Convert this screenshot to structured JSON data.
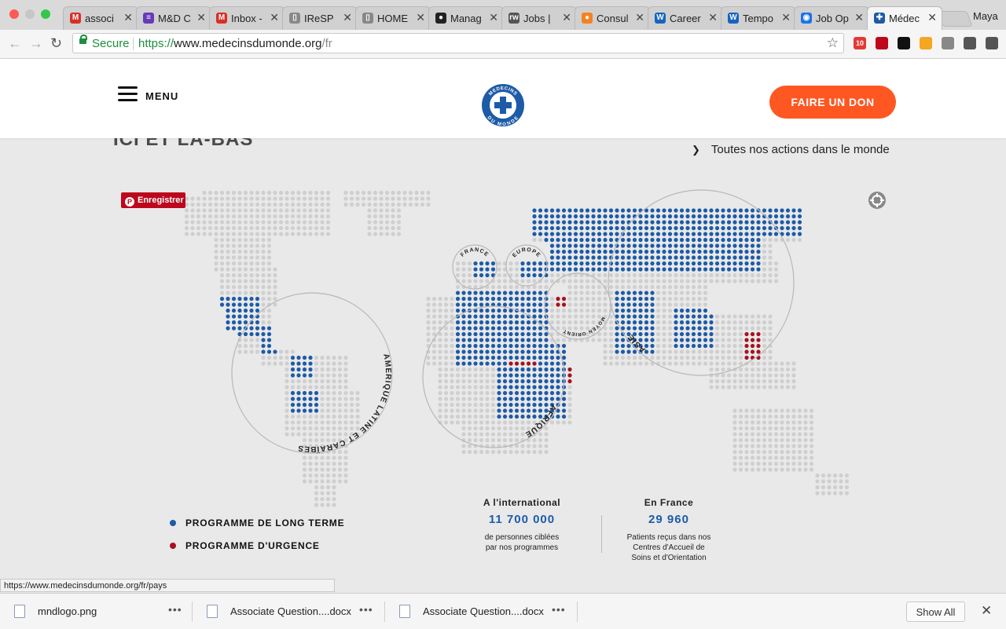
{
  "browser": {
    "tabs": [
      {
        "title": "associ",
        "icon": "gmail-icon",
        "color": "#d93025",
        "glyph": "M"
      },
      {
        "title": "M&D C",
        "icon": "sheets-icon",
        "color": "#673ab7",
        "glyph": "≡"
      },
      {
        "title": "Inbox -",
        "icon": "gmail-icon",
        "color": "#d93025",
        "glyph": "M"
      },
      {
        "title": "IReSP",
        "icon": "document-icon",
        "color": "#888888",
        "glyph": "▯"
      },
      {
        "title": "HOME",
        "icon": "document-icon",
        "color": "#888888",
        "glyph": "▯"
      },
      {
        "title": "Manag",
        "icon": "site-icon",
        "color": "#222222",
        "glyph": "●"
      },
      {
        "title": "Jobs |",
        "icon": "site-icon",
        "color": "#555555",
        "glyph": "rw"
      },
      {
        "title": "Consul",
        "icon": "orange-dot-icon",
        "color": "#f5821f",
        "glyph": "●"
      },
      {
        "title": "Career",
        "icon": "w-logo-icon",
        "color": "#1565c0",
        "glyph": "W"
      },
      {
        "title": "Tempo",
        "icon": "w-logo-icon",
        "color": "#1565c0",
        "glyph": "W"
      },
      {
        "title": "Job Op",
        "icon": "globe-icon",
        "color": "#1a73e8",
        "glyph": "◉"
      },
      {
        "title": "Médec",
        "icon": "mdm-logo-icon",
        "color": "#1d5ba8",
        "glyph": "✚"
      }
    ],
    "active_tab": 11,
    "profile": "Maya",
    "secure_label": "Secure",
    "url": {
      "scheme": "https://",
      "host": "www.medecinsdumonde.org",
      "path": "/fr"
    },
    "extensions": [
      {
        "icon": "adblock-icon",
        "color": "#e53935",
        "badge": "10"
      },
      {
        "icon": "pinterest-icon",
        "color": "#bd081c",
        "badge": ""
      },
      {
        "icon": "p-extension-icon",
        "color": "#111111",
        "badge": ""
      },
      {
        "icon": "honey-icon",
        "color": "#f5a623",
        "badge": ""
      },
      {
        "icon": "extension-icon",
        "color": "#888888",
        "badge": ""
      },
      {
        "icon": "cast-icon",
        "color": "#555555",
        "badge": ""
      },
      {
        "icon": "kebab-menu-icon",
        "color": "#555555",
        "badge": ""
      }
    ]
  },
  "site": {
    "menu_label": "MENU",
    "donate_label": "FAIRE UN DON",
    "logo_text": [
      "MEDECINS",
      "DU MONDE"
    ],
    "brand_color": "#1d5ba8",
    "accent_color": "#ff5722"
  },
  "content": {
    "section_title": "ICI ET LÀ-BAS",
    "all_actions_link": "Toutes nos actions dans le monde",
    "pinterest_save": "Enregistrer"
  },
  "map": {
    "regions": [
      "FRANCE",
      "EUROPE",
      "MOYEN ORIENT",
      "ASIE",
      "AFRIQUE",
      "AMERIQUE LATINE ET CARAÏBES"
    ],
    "colors": {
      "long_term": "#1d5ba8",
      "emergency": "#a5121f",
      "inactive": "#cfcfcf"
    }
  },
  "legend": {
    "long_term": "PROGRAMME DE LONG TERME",
    "emergency": "PROGRAMME D'URGENCE"
  },
  "stats": {
    "international": {
      "heading": "A l'international",
      "number": "11 700 000",
      "desc_line1": "de personnes ciblées",
      "desc_line2": "par nos programmes"
    },
    "france": {
      "heading": "En France",
      "number": "29 960",
      "desc_line1": "Patients reçus dans nos",
      "desc_line2": "Centres d'Accueil de",
      "desc_line3": "Soins et d'Orientation"
    }
  },
  "status_url": "https://www.medecinsdumonde.org/fr/pays",
  "downloads": {
    "items": [
      {
        "name": "mndlogo.png"
      },
      {
        "name": "Associate Question....docx"
      },
      {
        "name": "Associate Question....docx"
      }
    ],
    "show_all_label": "Show All"
  }
}
